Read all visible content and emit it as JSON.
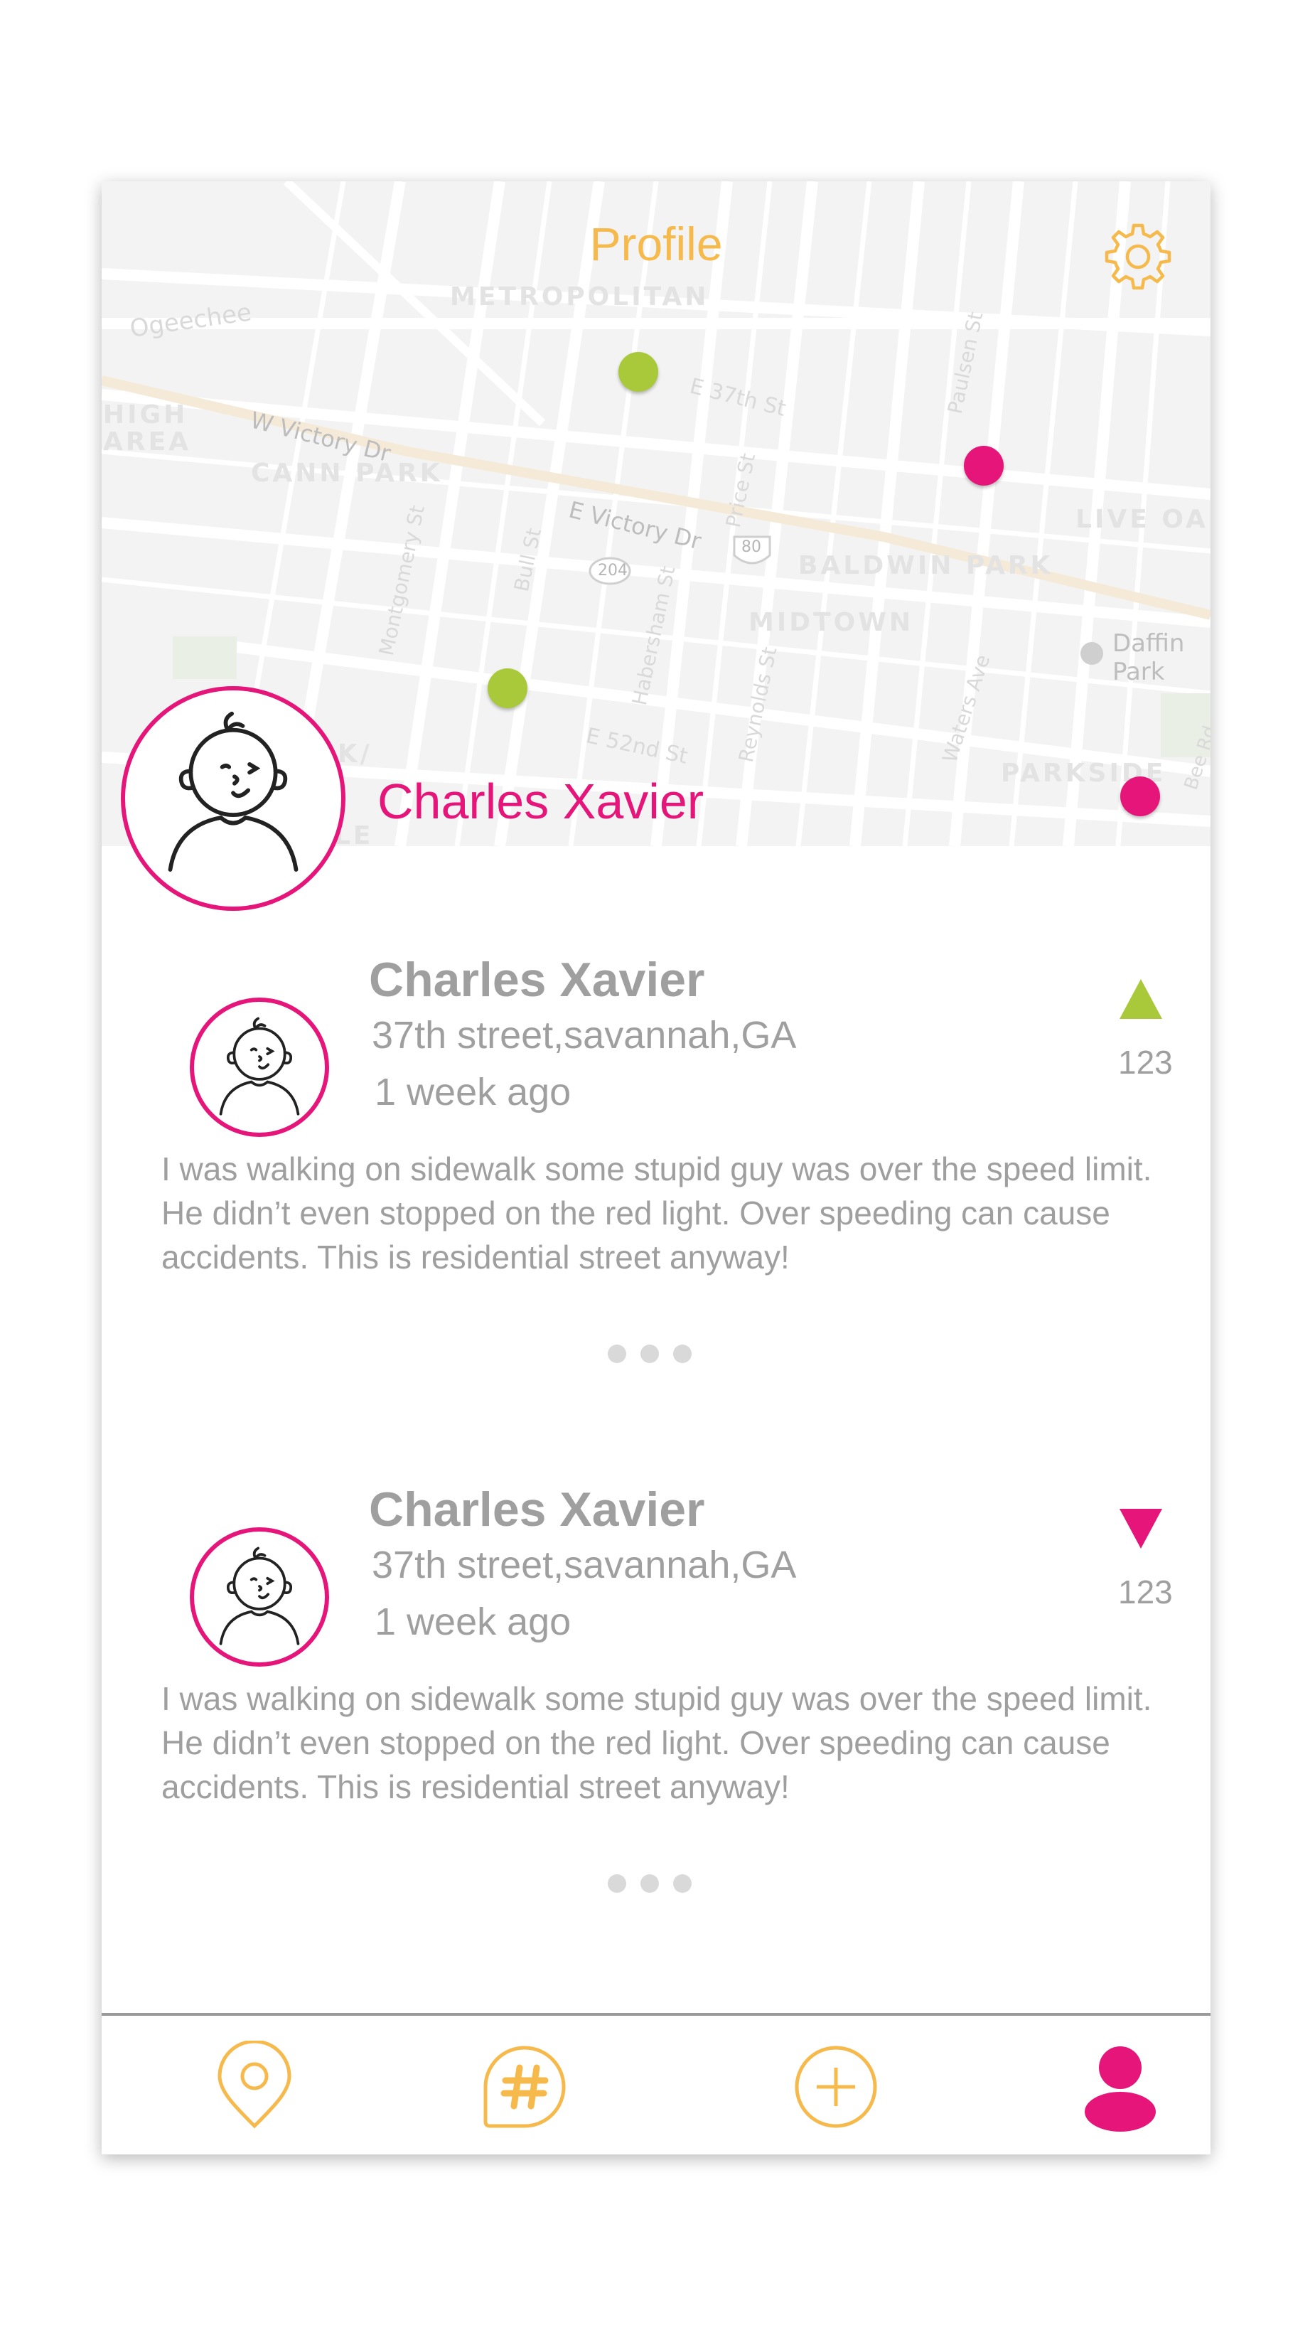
{
  "header": {
    "title": "Profile"
  },
  "icons": {
    "settings": "gear-icon",
    "location_tab": "map-pin-icon",
    "hashtag_tab": "hashtag-icon",
    "add_tab": "plus-circle-icon",
    "profile_tab": "user-icon"
  },
  "colors": {
    "accent": "#f6b94c",
    "brand": "#e6157a",
    "upvote": "#a9c93a",
    "text_gray": "#9f9f9f"
  },
  "map": {
    "labels": [
      "Ogeechee",
      "METROPOLITAN",
      "E 37th St",
      "W Victory Dr",
      "HIGH AREA",
      "CANN PARK",
      "E Victory Dr",
      "Montgomery St",
      "Bull St",
      "204",
      "80",
      "Price St",
      "Habersham St",
      "MIDTOWN",
      "BALDWIN PARK",
      "Paulsen St",
      "LIVE OAK",
      "Daffin Park Activity",
      "Reynolds St",
      "Waters Ave",
      "PARKSIDE",
      "E 52nd St",
      "Bee Rd",
      "RK/",
      "LLE"
    ]
  },
  "profile": {
    "name": "Charles Xavier"
  },
  "posts": [
    {
      "author": "Charles Xavier",
      "location": "37th street,savannah,GA",
      "time": "1 week ago",
      "body": "I was walking on sidewalk some stupid guy was over the speed limit. He didn’t even stopped on the red light. Over speeding can cause accidents. This is residential street anyway!",
      "vote": "up",
      "count": "123"
    },
    {
      "author": "Charles Xavier",
      "location": "37th street,savannah,GA",
      "time": "1 week ago",
      "body": "I was walking on sidewalk some stupid guy was over the speed limit. He didn’t even stopped on the red light. Over speeding can cause accidents. This is residential street anyway!",
      "vote": "down",
      "count": "123"
    }
  ],
  "nav": {
    "active": "profile"
  }
}
